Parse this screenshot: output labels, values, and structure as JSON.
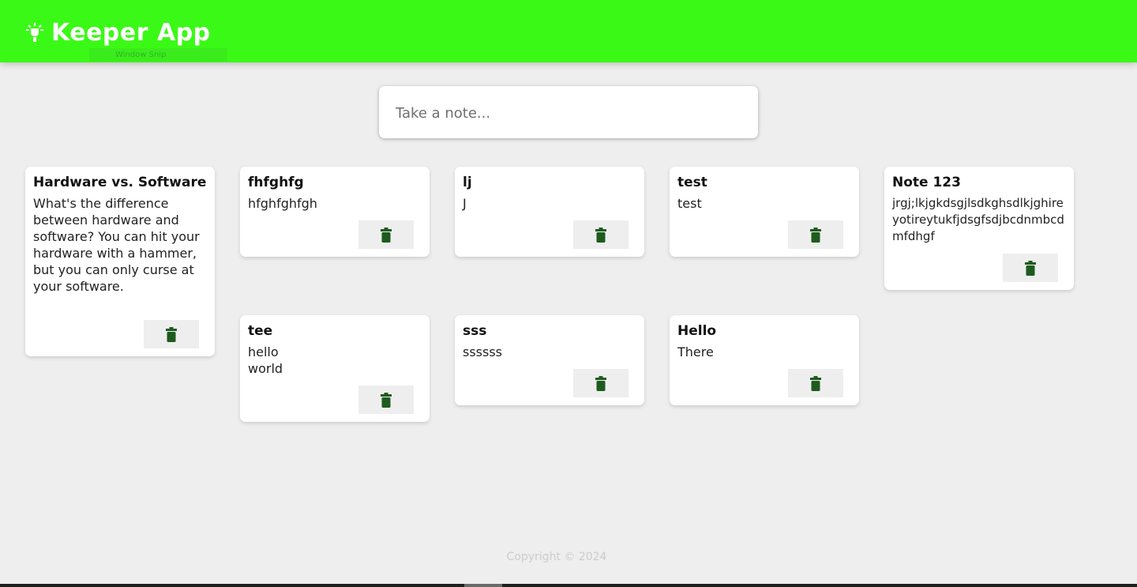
{
  "header": {
    "title": "Keeper App",
    "icon": "lightbulb-icon",
    "brand_color": "#3bf916",
    "snip_label": "Window Snip"
  },
  "create_note": {
    "placeholder": "Take a note...",
    "value": ""
  },
  "notes": [
    {
      "title": "Hardware vs. Software",
      "content": "What's the difference between hardware and software? You can hit your hardware with a hammer, but you can only curse at your software."
    },
    {
      "title": "fhfghfg",
      "content": "hfghfghfgh"
    },
    {
      "title": "lj",
      "content": "J"
    },
    {
      "title": "test",
      "content": "test"
    },
    {
      "title": "Note 123",
      "content": "jrgj;lkjgkdsgjlsdkghsdlkjghireyotireytukfjdsgfsdjbcdnmbcdmfdhgf"
    },
    {
      "title": "tee",
      "content": "hello\nworld"
    },
    {
      "title": "sss",
      "content": "ssssss"
    },
    {
      "title": "Hello",
      "content": "There"
    }
  ],
  "delete_icon": "trash-icon",
  "delete_icon_color": "#1e5b1e",
  "footer": {
    "copyright": "Copyright © 2024"
  }
}
